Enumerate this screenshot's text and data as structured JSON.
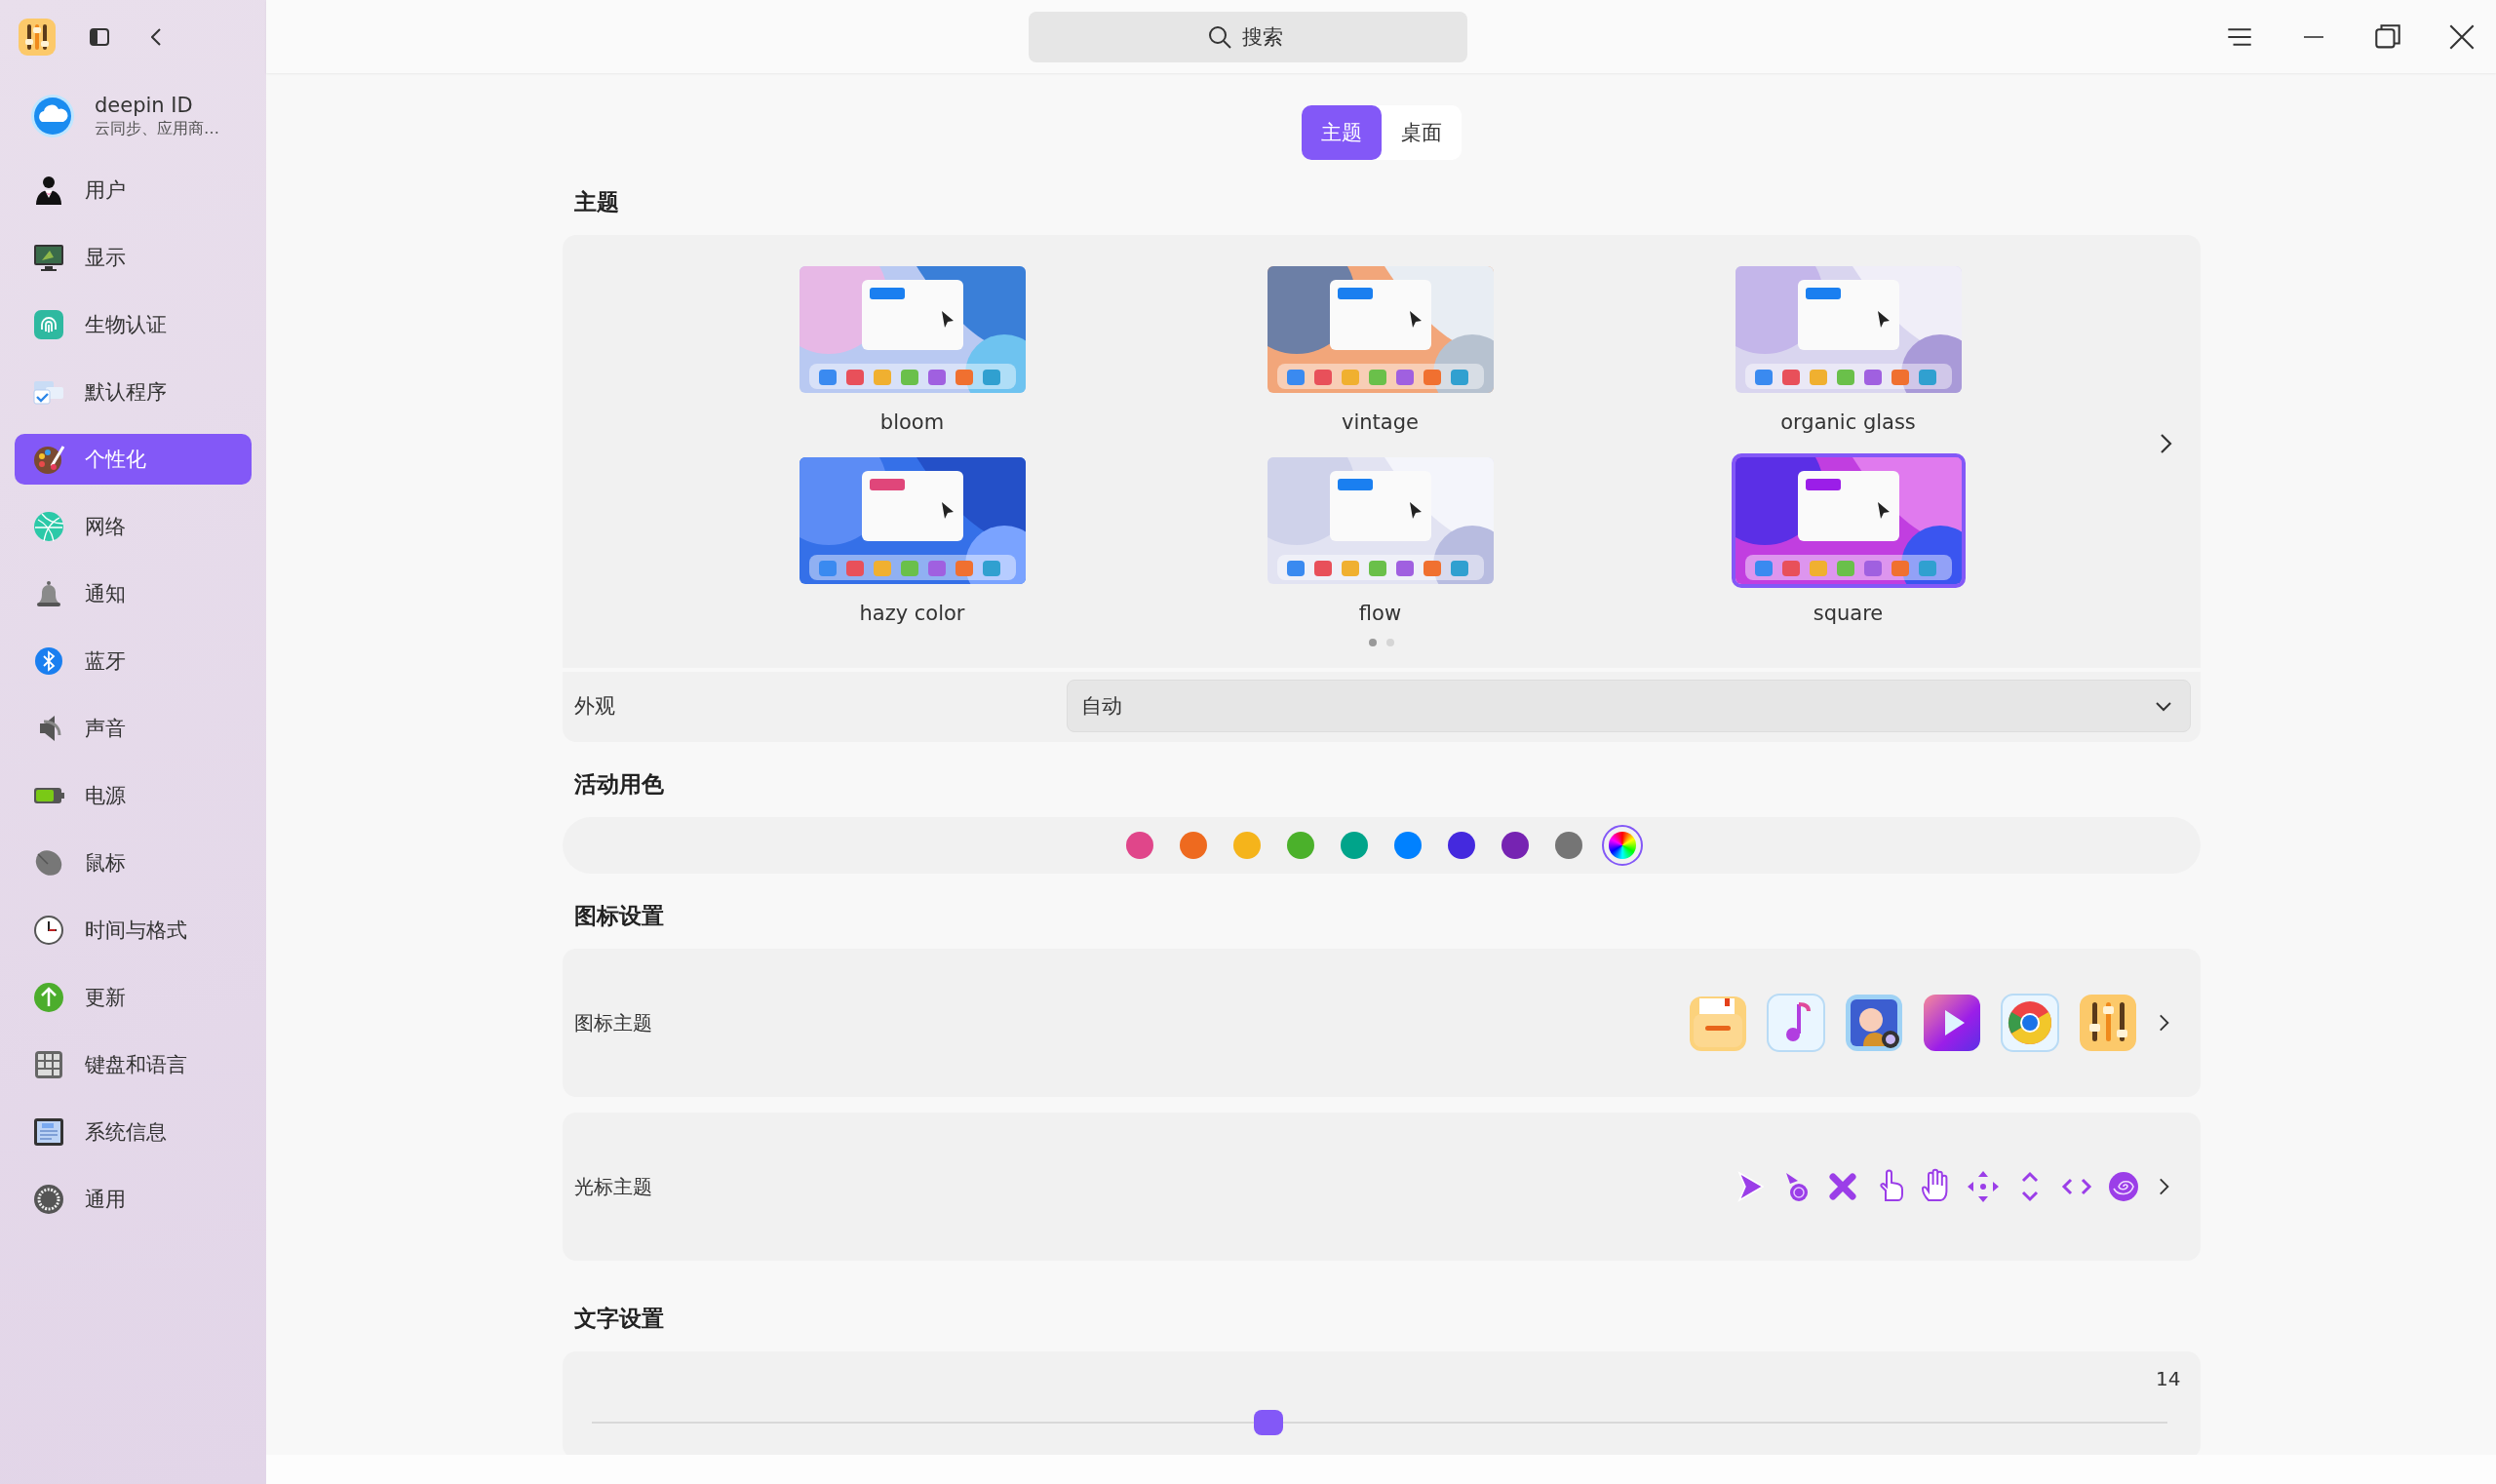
{
  "sidebar": {
    "account": {
      "name": "deepin ID",
      "subtitle": "云同步、应用商…"
    },
    "items": [
      {
        "label": "用户",
        "selected": false
      },
      {
        "label": "显示",
        "selected": false
      },
      {
        "label": "生物认证",
        "selected": false
      },
      {
        "label": "默认程序",
        "selected": false
      },
      {
        "label": "个性化",
        "selected": true
      },
      {
        "label": "网络",
        "selected": false
      },
      {
        "label": "通知",
        "selected": false
      },
      {
        "label": "蓝牙",
        "selected": false
      },
      {
        "label": "声音",
        "selected": false
      },
      {
        "label": "电源",
        "selected": false
      },
      {
        "label": "鼠标",
        "selected": false
      },
      {
        "label": "时间与格式",
        "selected": false
      },
      {
        "label": "更新",
        "selected": false
      },
      {
        "label": "键盘和语言",
        "selected": false
      },
      {
        "label": "系统信息",
        "selected": false
      },
      {
        "label": "通用",
        "selected": false
      }
    ]
  },
  "search": {
    "placeholder": "搜索"
  },
  "tabs": [
    {
      "label": "主题",
      "selected": true
    },
    {
      "label": "桌面",
      "selected": false
    }
  ],
  "theme": {
    "title": "主题",
    "themes": [
      {
        "name": "bloom",
        "selected": false
      },
      {
        "name": "vintage",
        "selected": false
      },
      {
        "name": "organic glass",
        "selected": false
      },
      {
        "name": "hazy color",
        "selected": false
      },
      {
        "name": "flow",
        "selected": false
      },
      {
        "name": "square",
        "selected": true
      }
    ],
    "pages": [
      {
        "selected": true
      },
      {
        "selected": false
      }
    ],
    "appearance": {
      "label": "外观",
      "value": "自动"
    }
  },
  "accent": {
    "title": "活动用色",
    "colors": [
      {
        "kind": "solid",
        "color": "#e0468a",
        "selected": false
      },
      {
        "kind": "solid",
        "color": "#ee6a1f",
        "selected": false
      },
      {
        "kind": "solid",
        "color": "#f5b41b",
        "selected": false
      },
      {
        "kind": "solid",
        "color": "#4bb12b",
        "selected": false
      },
      {
        "kind": "solid",
        "color": "#00a48a",
        "selected": false
      },
      {
        "kind": "solid",
        "color": "#0081ff",
        "selected": false
      },
      {
        "kind": "solid",
        "color": "#4429de",
        "selected": false
      },
      {
        "kind": "solid",
        "color": "#7623b2",
        "selected": false
      },
      {
        "kind": "solid",
        "color": "#757575",
        "selected": false
      },
      {
        "kind": "custom",
        "selected": true
      }
    ]
  },
  "icon_settings": {
    "title": "图标设置",
    "rows": [
      {
        "kind": "app-icons",
        "label": "图标主题"
      },
      {
        "kind": "cursors",
        "label": "光标主题"
      }
    ]
  },
  "text_settings": {
    "title": "文字设置",
    "font_size": {
      "reading": "14",
      "level": 0.43
    }
  }
}
